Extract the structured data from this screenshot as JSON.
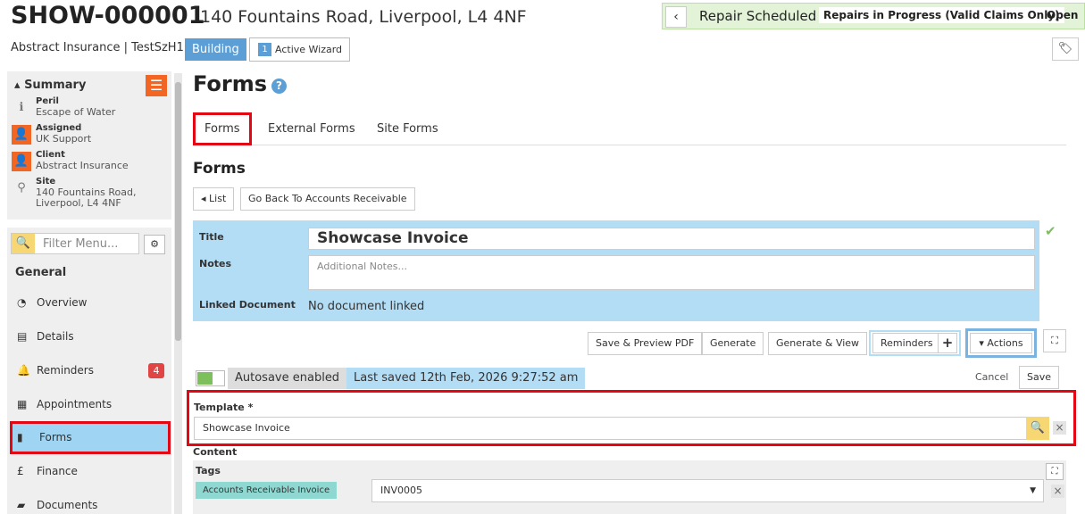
{
  "header": {
    "job_id": "SHOW-000001",
    "address": "140 Fountains Road, Liverpool, L4 4NF",
    "status": {
      "current": "Repair Scheduled",
      "next": "Repairs in Progress (Valid Claims Only)",
      "state": "Open"
    },
    "subtitle": "Abstract Insurance | TestSzH1",
    "category_badge": "Building",
    "wizard": {
      "count": "1",
      "label": "Active Wizard"
    }
  },
  "summary": {
    "title": "Summary",
    "items": [
      {
        "label": "Peril",
        "value": "Escape of Water",
        "icon": "info-icon"
      },
      {
        "label": "Assigned",
        "value": "UK Support",
        "icon": "user-icon"
      },
      {
        "label": "Client",
        "value": "Abstract Insurance",
        "icon": "user-icon"
      },
      {
        "label": "Site",
        "value": "140 Fountains Road,",
        "value2": "Liverpool, L4 4NF",
        "icon": "map-pin-icon"
      }
    ]
  },
  "menu": {
    "filter_placeholder": "Filter Menu...",
    "section": "General",
    "items": [
      {
        "label": "Overview",
        "icon": "dashboard-icon"
      },
      {
        "label": "Details",
        "icon": "clipboard-icon"
      },
      {
        "label": "Reminders",
        "icon": "bell-icon",
        "badge": "4"
      },
      {
        "label": "Appointments",
        "icon": "calendar-icon"
      },
      {
        "label": "Forms",
        "icon": "file-icon",
        "active": true
      },
      {
        "label": "Finance",
        "icon": "pound-icon"
      },
      {
        "label": "Documents",
        "icon": "folder-icon"
      }
    ]
  },
  "page": {
    "title": "Forms",
    "tabs": [
      "Forms",
      "External Forms",
      "Site Forms"
    ],
    "section_title": "Forms",
    "list_button": "List",
    "back_button": "Go Back To Accounts Receivable"
  },
  "form": {
    "title_label": "Title",
    "title_value": "Showcase Invoice",
    "notes_label": "Notes",
    "notes_placeholder": "Additional Notes...",
    "linked_label": "Linked Document",
    "linked_value": "No document linked"
  },
  "toolbar": {
    "save_preview": "Save & Preview PDF",
    "generate": "Generate",
    "generate_view": "Generate & View",
    "reminders": "Reminders",
    "add": "+",
    "actions": "Actions"
  },
  "autosave": {
    "enabled_label": "Autosave enabled",
    "last_saved": "Last saved 12th Feb, 2026 9:27:52 am",
    "cancel": "Cancel",
    "save": "Save"
  },
  "template": {
    "label": "Template *",
    "value": "Showcase Invoice"
  },
  "content": {
    "label": "Content",
    "tags_label": "Tags",
    "tag_chip": "Accounts Receivable Invoice",
    "tag_value": "INV0005"
  }
}
